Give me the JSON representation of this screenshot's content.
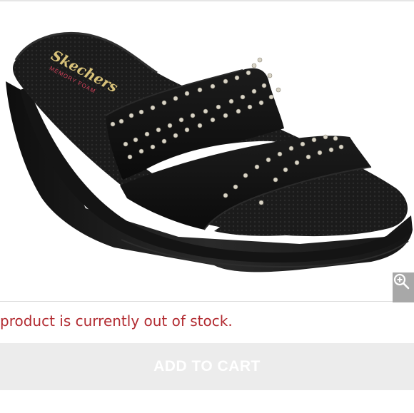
{
  "product_image": {
    "alt": "black studded wedge slide sandal",
    "brand_logo": "Skechers",
    "insole_text": "MEMORY FOAM"
  },
  "zoom": {
    "icon": "zoom-in-icon"
  },
  "stock_message": "product is currently out of stock.",
  "add_to_cart": {
    "label": "ADD TO CART"
  },
  "colors": {
    "stock_message": "#b22b31",
    "button_bg": "#ececec",
    "zoom_bg": "#a8a8a8"
  }
}
